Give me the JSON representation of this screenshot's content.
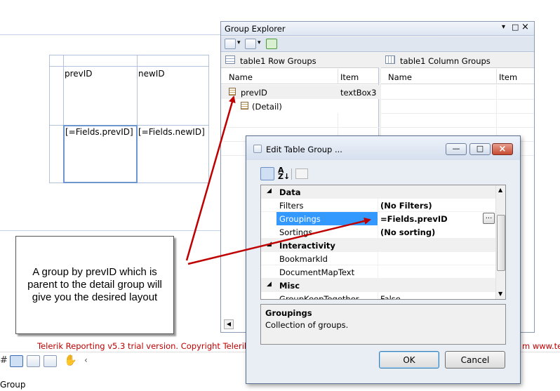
{
  "designer": {
    "header_cells": {
      "left": "prevID",
      "right": "newID"
    },
    "data_cells": {
      "left": "[=Fields.prevID]",
      "right": "[=Fields.newID]"
    },
    "trial_text": "Telerik Reporting v5.3 trial version. Copyright Telerik © 2",
    "trial_text_tail": "m www.tel",
    "bottom_text": "Group"
  },
  "callout": {
    "text": "A group by prevID which is parent to the detail group will give you the desired layout"
  },
  "group_explorer": {
    "title": "Group Explorer",
    "row_groups_title": "table1 Row Groups",
    "column_groups_title": "table1 Column Groups",
    "col_name": "Name",
    "col_item": "Item",
    "rows": [
      {
        "name": "prevID",
        "item": "textBox3"
      },
      {
        "name": "(Detail)",
        "item": ""
      }
    ]
  },
  "edit_dialog": {
    "title": "Edit Table Group ...",
    "categories": {
      "data": "Data",
      "interactivity": "Interactivity",
      "misc": "Misc"
    },
    "properties": {
      "filters": {
        "name": "Filters",
        "value": "(No Filters)"
      },
      "groupings": {
        "name": "Groupings",
        "value": "=Fields.prevID"
      },
      "sortings": {
        "name": "Sortings",
        "value": "(No sorting)"
      },
      "bookmark": {
        "name": "BookmarkId",
        "value": ""
      },
      "docmap": {
        "name": "DocumentMapText",
        "value": ""
      },
      "keeptogether": {
        "name": "GroupKeepTogether",
        "value": "False"
      }
    },
    "ellipsis": "...",
    "desc_title": "Groupings",
    "desc_text": "Collection of groups.",
    "ok": "OK",
    "cancel": "Cancel"
  },
  "colors": {
    "selection": "#3399ff",
    "arrow": "#c00000",
    "trial_text": "#c00000",
    "title_bar": "#dde6f2"
  }
}
